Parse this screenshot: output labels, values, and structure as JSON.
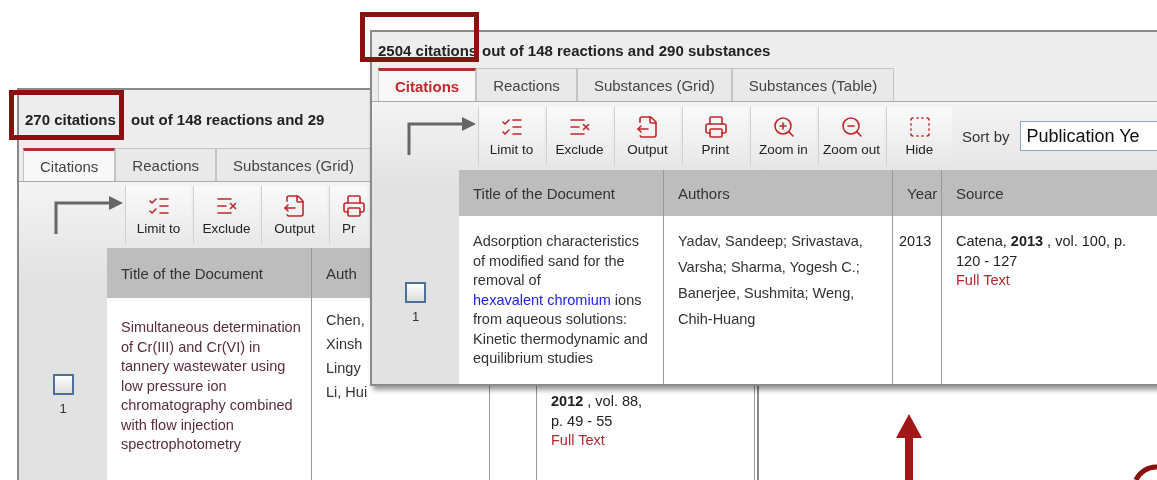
{
  "back_window": {
    "header": {
      "count": "270 citations",
      "rest": "out of 148 reactions and 29"
    },
    "tabs": [
      {
        "label": "Citations",
        "selected": true
      },
      {
        "label": "Reactions",
        "selected": false
      },
      {
        "label": "Substances (Grid)",
        "selected": false
      }
    ],
    "toolbar": [
      {
        "kind": "limit",
        "label": "Limit to"
      },
      {
        "kind": "exclude",
        "label": "Exclude"
      },
      {
        "kind": "output",
        "label": "Output"
      },
      {
        "kind": "print",
        "label": "Pr"
      }
    ],
    "columns": [
      "Title of the Document",
      "Auth"
    ],
    "row": {
      "number": "1",
      "checked": false,
      "title": "Simultaneous determination of Cr(III) and Cr(VI) in tannery wastewater using low pressure ion chromatography combined with flow injection spectrophotometry",
      "authors": [
        "Chen,",
        "Xinsh",
        "Lingy",
        "Li, Hui"
      ],
      "source": "**2012** , vol. 88,",
      "pages": "p. 49 - 55",
      "full_text": "Full Text"
    }
  },
  "front_window": {
    "header": {
      "count": "2504 citations",
      "rest": "out of 148 reactions and 290 substances"
    },
    "tabs": [
      {
        "label": "Citations",
        "selected": true
      },
      {
        "label": "Reactions",
        "selected": false
      },
      {
        "label": "Substances (Grid)",
        "selected": false
      },
      {
        "label": "Substances (Table)",
        "selected": false
      }
    ],
    "toolbar": [
      {
        "kind": "limit",
        "label": "Limit to"
      },
      {
        "kind": "exclude",
        "label": "Exclude"
      },
      {
        "kind": "output",
        "label": "Output"
      },
      {
        "kind": "print",
        "label": "Print"
      },
      {
        "kind": "zoom_in",
        "label": "Zoom in"
      },
      {
        "kind": "zoom_out",
        "label": "Zoom out"
      },
      {
        "kind": "hide",
        "label": "Hide"
      }
    ],
    "sort": {
      "label": "Sort by",
      "value": "Publication Ye"
    },
    "columns": [
      "Title of the Document",
      "Authors",
      "Year",
      "Source"
    ],
    "row": {
      "number": "1",
      "checked": false,
      "title_before": "Adsorption characteristics of modified sand for the removal of",
      "title_link": "hexavalent chromium",
      "title_after": "ions from aqueous solutions: Kinetic thermodynamic and equilibrium studies",
      "authors": "Yadav, Sandeep; Srivastava, Varsha; Sharma, Yogesh C.; Banerjee, Sushmita; Weng, Chih-Huang",
      "year": "2013",
      "source": "Catena,  **2013** ,  vol. 100, p. 120 - 127",
      "full_text": "Full Text"
    }
  }
}
